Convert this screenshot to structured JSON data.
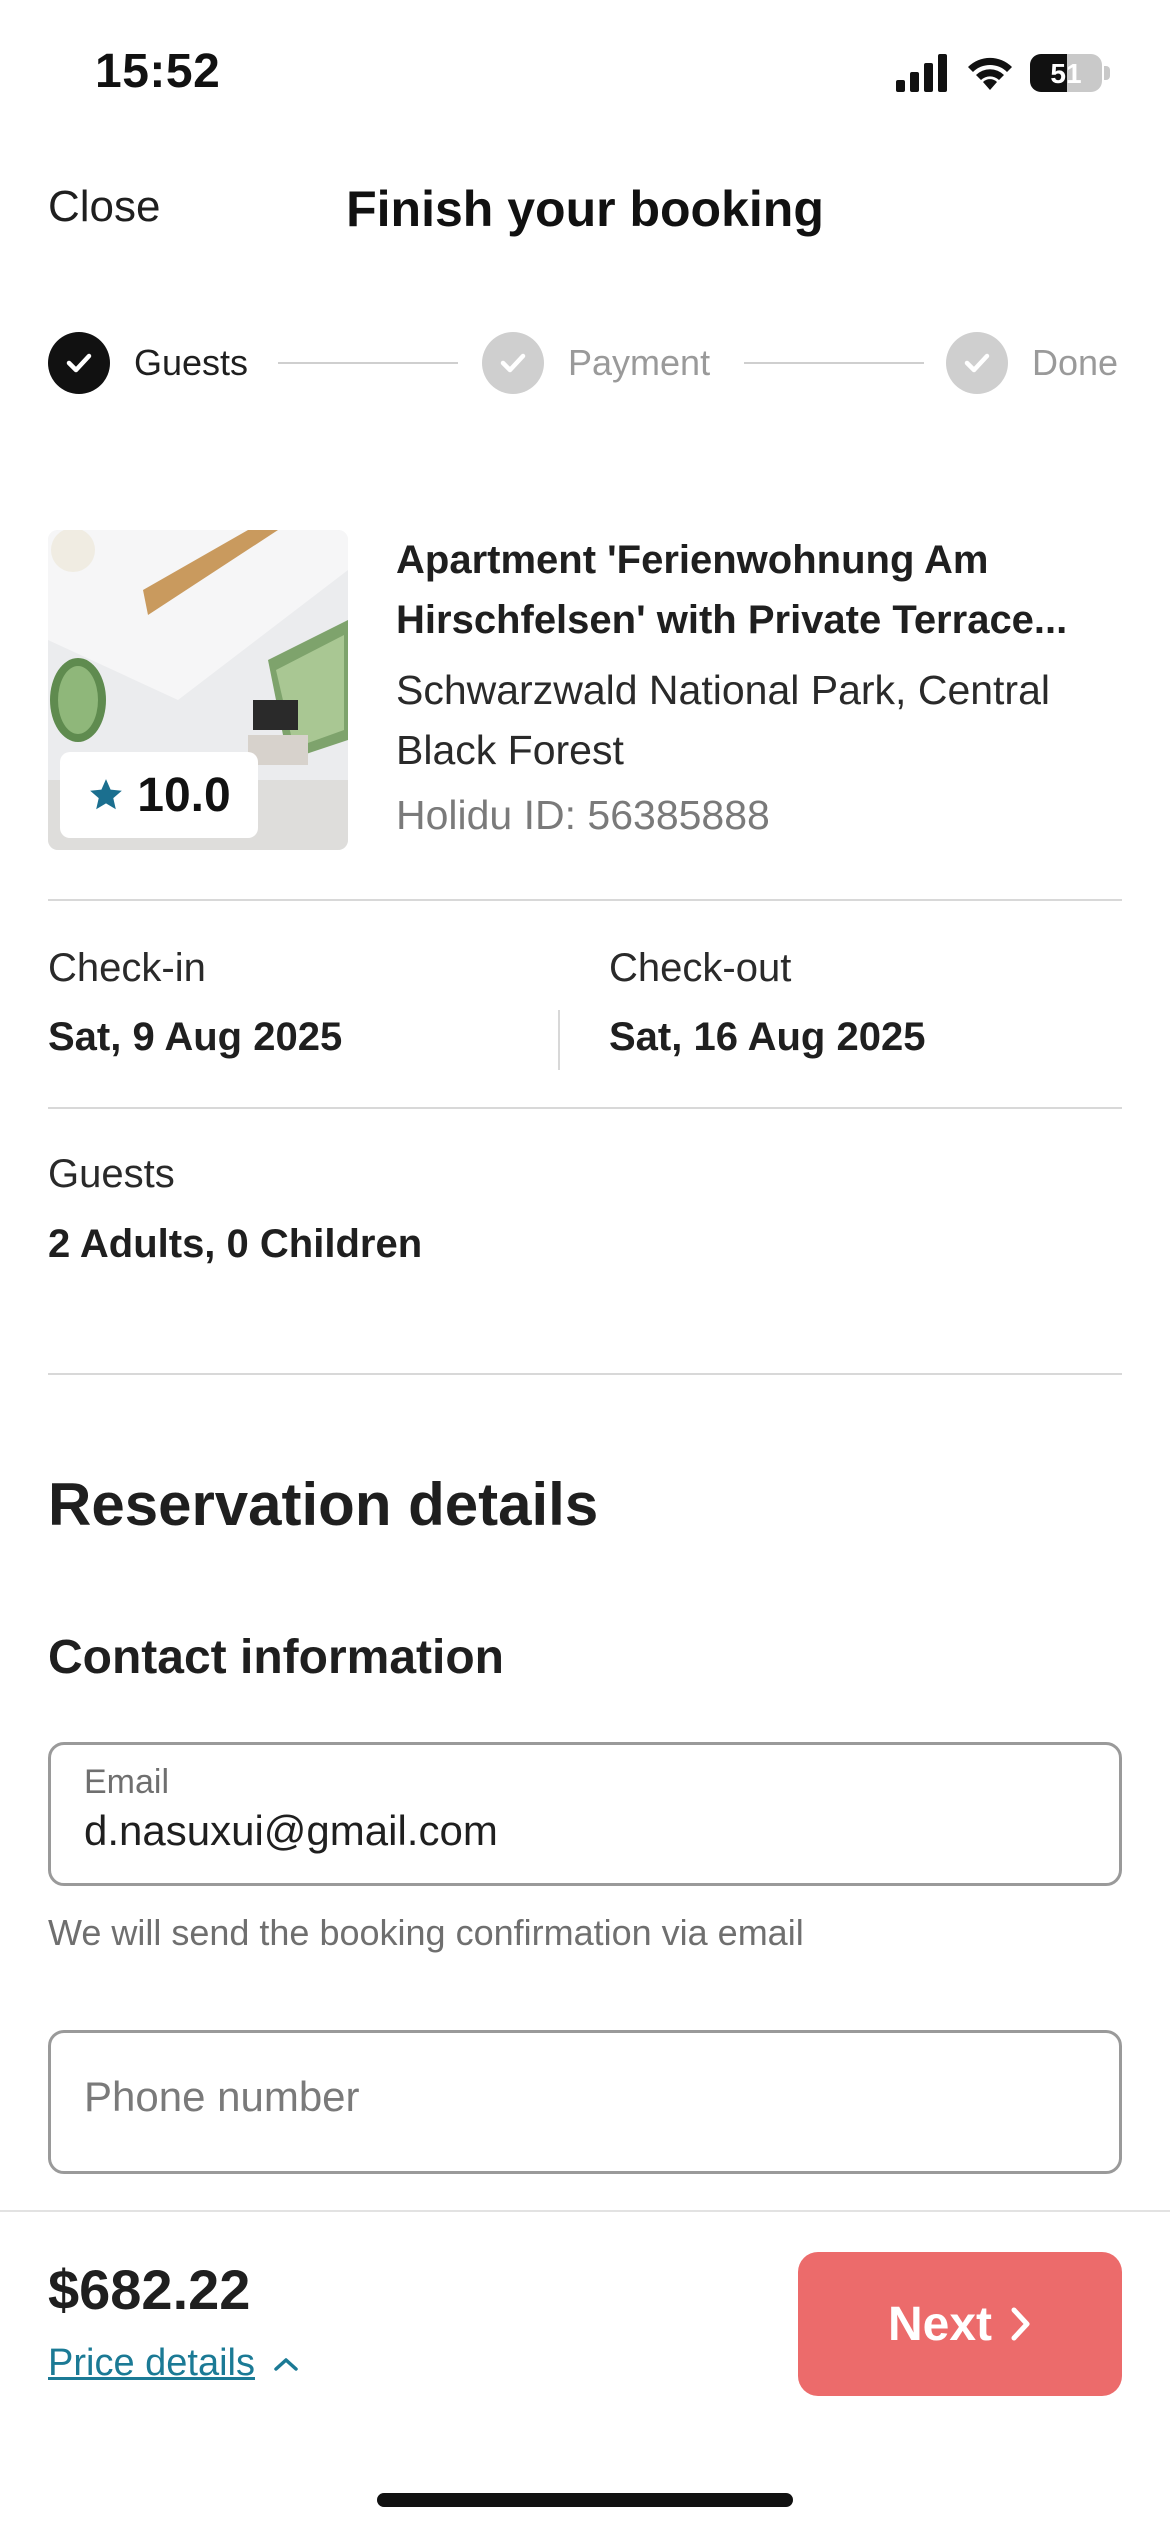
{
  "status_bar": {
    "time": "15:52",
    "battery": "51",
    "battery_level": 0.51
  },
  "header": {
    "close_label": "Close",
    "title": "Finish your booking"
  },
  "stepper": {
    "steps": [
      {
        "label": "Guests",
        "state": "active"
      },
      {
        "label": "Payment",
        "state": "inactive"
      },
      {
        "label": "Done",
        "state": "inactive"
      }
    ]
  },
  "property": {
    "title_line1": "Apartment 'Ferienwohnung Am",
    "title_line2": "Hirschfelsen' with Private Terrace...",
    "location": "Schwarzwald National Park, Central Black Forest",
    "holidu_id": "Holidu ID: 56385888",
    "rating": "10.0",
    "rating_color": "#1b6f8f"
  },
  "stay": {
    "checkin_label": "Check-in",
    "checkin_value": "Sat, 9 Aug 2025",
    "checkout_label": "Check-out",
    "checkout_value": "Sat, 16 Aug 2025",
    "guests_label": "Guests",
    "guests_value": "2 Adults, 0 Children"
  },
  "reservation": {
    "section_title": "Reservation details",
    "contact_title": "Contact information",
    "email_label": "Email",
    "email_value": "d.nasuxui@gmail.com",
    "email_helper": "We will send the booking confirmation via email",
    "phone_placeholder": "Phone number"
  },
  "footer": {
    "price": "$682.22",
    "price_details_label": "Price details",
    "next_label": "Next",
    "next_color": "#ec6b6b"
  }
}
